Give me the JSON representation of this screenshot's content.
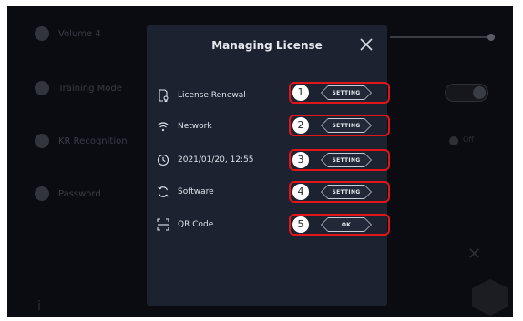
{
  "background": {
    "rows": [
      "Volume 4",
      "Training Mode",
      "KR Recognition",
      "Password"
    ],
    "radio_label": "Off"
  },
  "modal": {
    "title": "Managing License",
    "items": [
      {
        "label": "License Renewal",
        "icon": "license-icon",
        "number": "1",
        "button": "SETTING"
      },
      {
        "label": "Network",
        "icon": "wifi-icon",
        "number": "2",
        "button": "SETTING"
      },
      {
        "label": "2021/01/20, 12:55",
        "icon": "clock-icon",
        "number": "3",
        "button": "SETTING"
      },
      {
        "label": "Software",
        "icon": "refresh-icon",
        "number": "4",
        "button": "SETTING"
      },
      {
        "label": "QR Code",
        "icon": "qr-scan-icon",
        "number": "5",
        "button": "OK"
      }
    ]
  },
  "colors": {
    "highlight": "#e0161b",
    "modal_bg": "#1d2231",
    "screen_bg": "#0b0c11"
  }
}
